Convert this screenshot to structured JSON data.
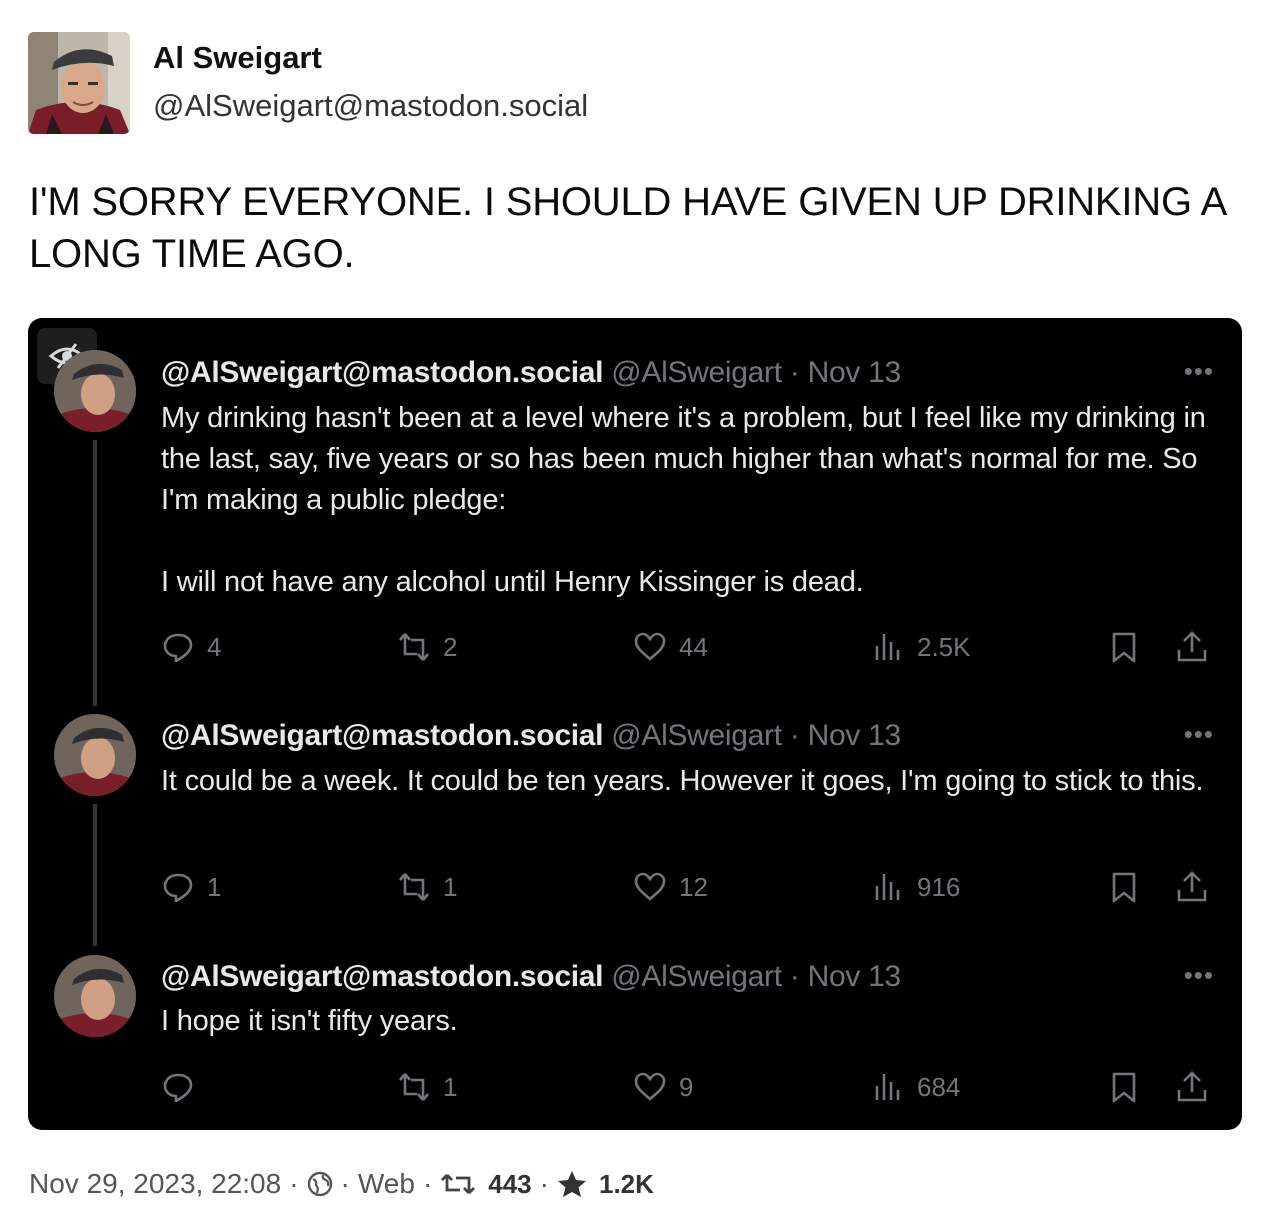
{
  "author": {
    "display_name": "Al Sweigart",
    "handle": "@AlSweigart@mastodon.social"
  },
  "status_text": "I'M SORRY EVERYONE. I SHOULD HAVE GIVEN UP DRINKING A LONG TIME AGO.",
  "embedded_tweets": [
    {
      "name": "@AlSweigart@mastodon.social",
      "username": "@AlSweigart",
      "date": "Nov 13",
      "paragraphs": [
        "My drinking hasn't been at a level where it's a problem, but I feel like my drinking in the last, say, five years or so has been much higher than what's normal for me. So I'm making a public pledge:",
        "I will not have any alcohol until Henry Kissinger is dead."
      ],
      "replies": "4",
      "retweets": "2",
      "likes": "44",
      "views": "2.5K"
    },
    {
      "name": "@AlSweigart@mastodon.social",
      "username": "@AlSweigart",
      "date": "Nov 13",
      "paragraphs": [
        "It could be a week. It could be ten years. However it goes, I'm going to stick to this."
      ],
      "replies": "1",
      "retweets": "1",
      "likes": "12",
      "views": "916"
    },
    {
      "name": "@AlSweigart@mastodon.social",
      "username": "@AlSweigart",
      "date": "Nov 13",
      "paragraphs": [
        "I hope it isn't fifty years."
      ],
      "replies": "",
      "retweets": "1",
      "likes": "9",
      "views": "684"
    }
  ],
  "more_label": "•••",
  "footer": {
    "timestamp": "Nov 29, 2023, 22:08",
    "separator": "·",
    "visibility_icon": "globe-icon",
    "app": "Web",
    "boosts": "443",
    "favourites": "1.2K"
  },
  "colors": {
    "tweet_bg": "#000000",
    "tweet_text": "#e7e9ea",
    "tweet_meta": "#71767b",
    "page_bg": "#ffffff"
  }
}
